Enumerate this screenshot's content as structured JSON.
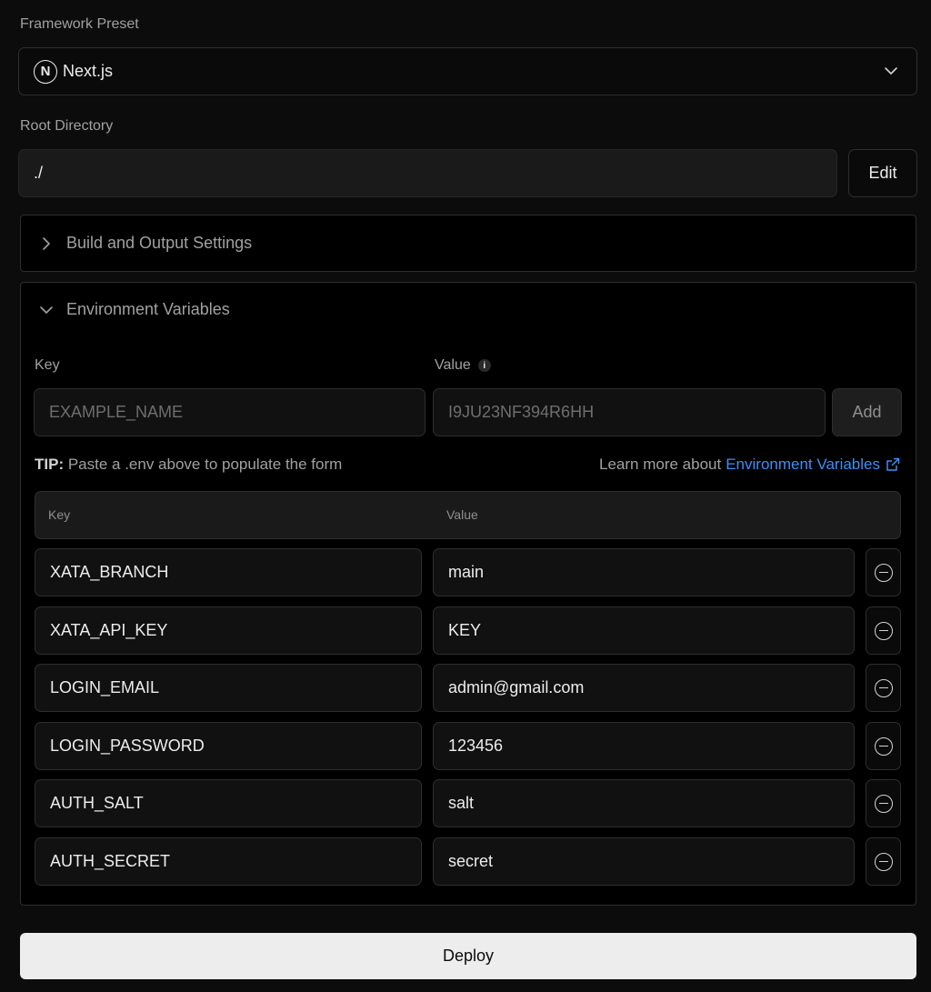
{
  "framework": {
    "label": "Framework Preset",
    "selected": "Next.js",
    "logo_letter": "N"
  },
  "root_directory": {
    "label": "Root Directory",
    "value": "./",
    "edit_label": "Edit"
  },
  "build_settings": {
    "title": "Build and Output Settings",
    "expanded": false
  },
  "env": {
    "title": "Environment Variables",
    "expanded": true,
    "key_label": "Key",
    "value_label": "Value",
    "key_placeholder": "EXAMPLE_NAME",
    "value_placeholder": "I9JU23NF394R6HH",
    "add_label": "Add",
    "tip_bold": "TIP:",
    "tip_text": " Paste a .env above to populate the form",
    "learn_prefix": "Learn more about",
    "learn_link": "Environment Variables",
    "table_key_header": "Key",
    "table_value_header": "Value",
    "rows": [
      {
        "key": "XATA_BRANCH",
        "value": "main"
      },
      {
        "key": "XATA_API_KEY",
        "value": "KEY"
      },
      {
        "key": "LOGIN_EMAIL",
        "value": "admin@gmail.com"
      },
      {
        "key": "LOGIN_PASSWORD",
        "value": "123456"
      },
      {
        "key": "AUTH_SALT",
        "value": "salt"
      },
      {
        "key": "AUTH_SECRET",
        "value": "secret"
      }
    ]
  },
  "deploy_label": "Deploy",
  "colors": {
    "background": "#0c0c0c",
    "link": "#3e8ef7",
    "deploy_bg": "#ededed"
  }
}
